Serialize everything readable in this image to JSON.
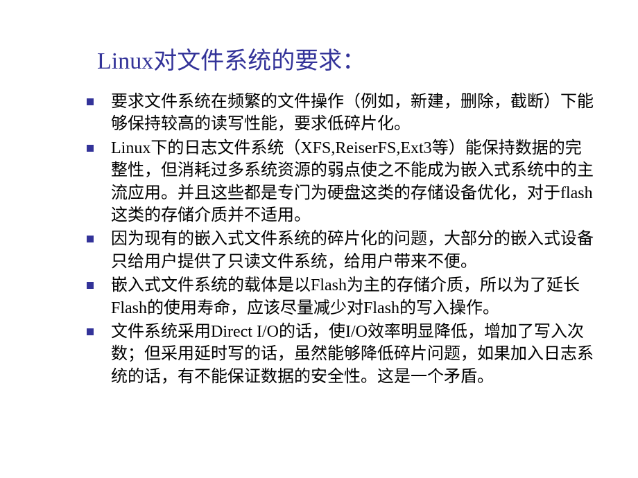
{
  "title": "Linux对文件系统的要求：",
  "bullets": [
    "要求文件系统在频繁的文件操作（例如，新建，删除，截断）下能够保持较高的读写性能，要求低碎片化。",
    "Linux下的日志文件系统（XFS,ReiserFS,Ext3等）能保持数据的完整性，但消耗过多系统资源的弱点使之不能成为嵌入式系统中的主流应用。并且这些都是专门为硬盘这类的存储设备优化，对于flash这类的存储介质并不适用。",
    "因为现有的嵌入式文件系统的碎片化的问题，大部分的嵌入式设备只给用户提供了只读文件系统，给用户带来不便。",
    "嵌入式文件系统的载体是以Flash为主的存储介质，所以为了延长Flash的使用寿命，应该尽量减少对Flash的写入操作。",
    "文件系统采用Direct I/O的话，使I/O效率明显降低，增加了写入次数；但采用延时写的话，虽然能够降低碎片问题，如果加入日志系统的话，有不能保证数据的安全性。这是一个矛盾。"
  ]
}
